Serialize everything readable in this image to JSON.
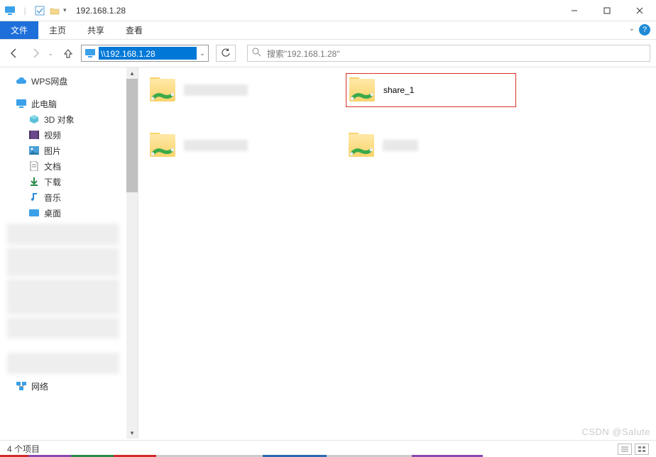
{
  "title": "192.168.1.28",
  "ribbon": {
    "file": "文件",
    "home": "主页",
    "share": "共享",
    "view": "查看"
  },
  "address": {
    "path": "\\\\192.168.1.28"
  },
  "search": {
    "placeholder": "搜索\"192.168.1.28\""
  },
  "nav": {
    "wps": "WPS网盘",
    "thispc": "此电脑",
    "objects3d": "3D 对象",
    "videos": "视频",
    "pictures": "图片",
    "documents": "文档",
    "downloads": "下载",
    "music": "音乐",
    "desktop": "桌面",
    "network": "网络"
  },
  "items": {
    "share1": "share_1"
  },
  "status": {
    "count": "4 个项目"
  },
  "watermark": "CSDN @Salute"
}
